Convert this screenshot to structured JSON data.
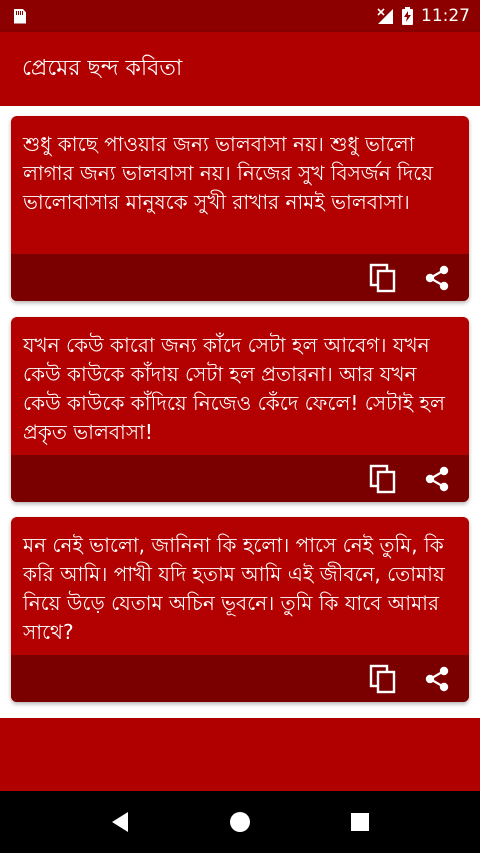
{
  "status_bar": {
    "time": "11:27"
  },
  "app_bar": {
    "title": "প্রেমের ছন্দ কবিতা"
  },
  "cards": [
    {
      "text": "শুধু কাছে পাওয়ার জন্য ভালবাসা নয়। শুধু ভালো লাগার জন্য ভালবাসা নয়। নিজের সুখ বিসর্জন দিয়ে ভালোবাসার মানুষকে সুখী রাখার নামই ভালবাসা।"
    },
    {
      "text": "যখন কেউ কারো জন্য কাঁদে সেটা হল আবেগ। যখন কেউ কাউকে কাঁদায় সেটা হল প্রতারনা। আর যখন কেউ কাউকে কাঁদিয়ে নিজেও কেঁদে ফেলে! সেটাই হল প্রকৃত ভালবাসা!"
    },
    {
      "text": "মন নেই ভালো, জানিনা কি হলো। পাসে নেই তুমি, কি করি আমি। পাখী যদি হতাম আমি এই জীবনে, তোমায় নিয়ে উড়ে যেতাম অচিন ভূবনে। তুমি কি যাবে আমার সাথে?"
    }
  ],
  "icons": {
    "copy": "copy-icon",
    "share": "share-icon"
  },
  "colors": {
    "status_bar": "#8d0000",
    "app_bar": "#b00000",
    "card": "#b30000",
    "card_actions": "#7a0000"
  }
}
